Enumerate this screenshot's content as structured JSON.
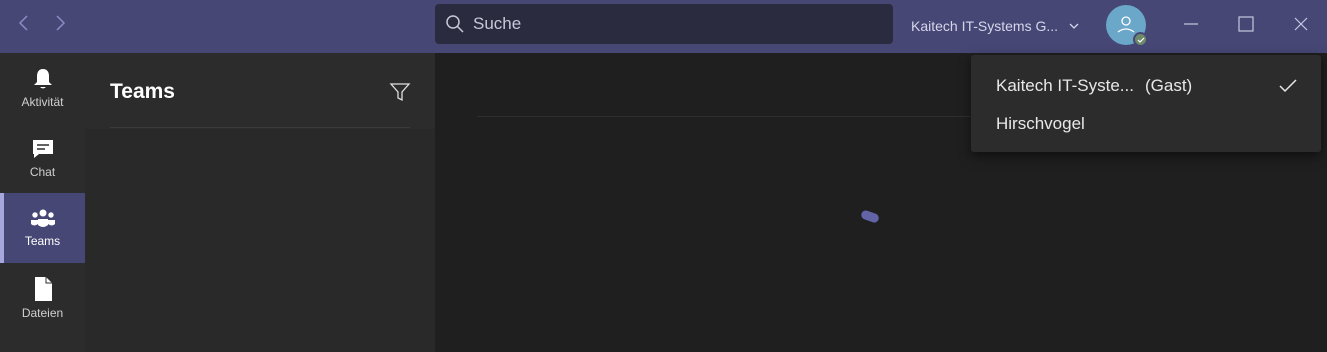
{
  "titlebar": {
    "search": {
      "placeholder": "Suche"
    },
    "tenant": {
      "name": "Kaitech IT-Systems G..."
    }
  },
  "rail": {
    "items": [
      {
        "label": "Aktivität",
        "icon": "bell-icon"
      },
      {
        "label": "Chat",
        "icon": "chat-icon"
      },
      {
        "label": "Teams",
        "icon": "teams-icon",
        "active": true
      },
      {
        "label": "Dateien",
        "icon": "file-icon"
      }
    ]
  },
  "panel": {
    "title": "Teams"
  },
  "dropdown": {
    "items": [
      {
        "name": "Kaitech IT-Syste...",
        "tag": "(Gast)",
        "selected": true
      },
      {
        "name": "Hirschvogel",
        "tag": "",
        "selected": false
      }
    ]
  },
  "colors": {
    "titlebar": "#464775",
    "accent": "#6264a7",
    "rail_active": "#464775"
  }
}
